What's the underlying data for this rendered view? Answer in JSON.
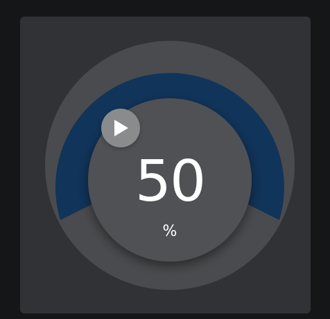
{
  "dial": {
    "value": "50",
    "unit": "%",
    "level": 0.5,
    "icon": "play-icon",
    "colors": {
      "background": "#151618",
      "card": "#303236",
      "track": "#4a4b4e",
      "fill": "#11345a",
      "knob": "#505154",
      "handle": "#8a8b8d",
      "text": "#ffffff"
    }
  }
}
